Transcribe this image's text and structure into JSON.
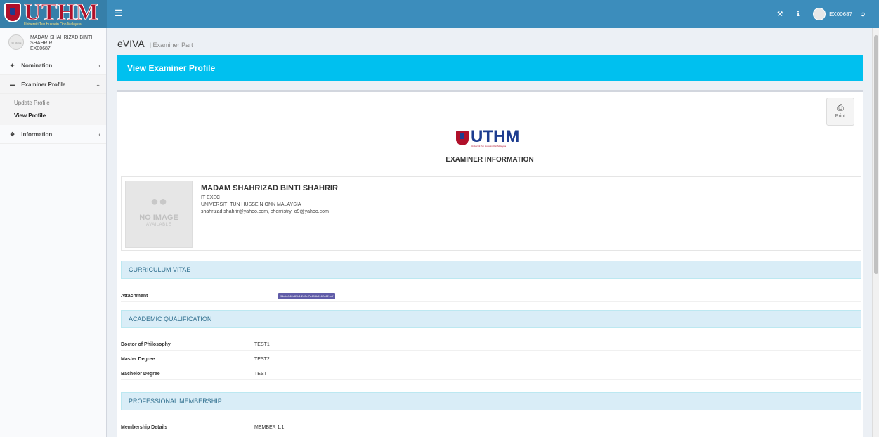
{
  "logo": {
    "text": "UTHM",
    "subtitle": "Universiti Tun Hussein Onn Malaysia"
  },
  "topbar": {
    "menu_icon": "bars-icon",
    "icons": [
      "tools-icon",
      "info-icon"
    ],
    "user_id": "EX00687",
    "logout_icon": "logout-icon"
  },
  "sidebar": {
    "avatar_text": "NO IMAGE",
    "user_name": "MADAM SHAHRIZAD BINTI SHAHRIR",
    "user_id": "EX00687",
    "items": [
      {
        "label": "Nomination",
        "icon": "pin-icon"
      },
      {
        "label": "Examiner Profile",
        "icon": "user-card-icon"
      },
      {
        "label": "Information",
        "icon": "info-circle-icon"
      }
    ],
    "submenu": [
      {
        "label": "Update Profile"
      },
      {
        "label": "View Profile"
      }
    ]
  },
  "header": {
    "title": "eVIVA",
    "subtitle": "| Examiner Part"
  },
  "banner": {
    "title": "View Examiner Profile"
  },
  "print": {
    "label": "Print"
  },
  "panel": {
    "logo_text": "UTHM",
    "logo_sub": "Universiti Tun Hussein Onn Malaysia",
    "title": "EXAMINER INFORMATION"
  },
  "profile": {
    "noimage_line1": "NO IMAGE",
    "noimage_line2": "AVAILABLE",
    "name": "MADAM SHAHRIZAD BINTI SHAHRIR",
    "position": "IT EXEC",
    "institution": "UNIVERSITI TUN HUSSEIN ONN MALAYSIA",
    "email": "shahrizad.shahrir@yahoo.com, chemistry_o9@yahoo.com"
  },
  "sections": {
    "cv": {
      "title": "CURRICULUM VITAE",
      "attachment_label": "Attachment",
      "attachment_file": "91abc742d87b1f240ef7e494b5162d42.pdf"
    },
    "academic": {
      "title": "ACADEMIC QUALIFICATION",
      "rows": [
        {
          "label": "Doctor of Philosophy",
          "value": "TEST1"
        },
        {
          "label": "Master Degree",
          "value": "TEST2"
        },
        {
          "label": "Bachelor Degree",
          "value": "TEST"
        }
      ]
    },
    "membership": {
      "title": "PROFESSIONAL MEMBERSHIP",
      "rows": [
        {
          "label": "Membership Details",
          "value": "MEMBER 1.1"
        }
      ]
    }
  },
  "colors": {
    "topbar": "#3c8dbc",
    "banner": "#00c0ef",
    "section": "#d9edf7",
    "badge": "#605ca8",
    "logo_red": "#b0102a"
  }
}
